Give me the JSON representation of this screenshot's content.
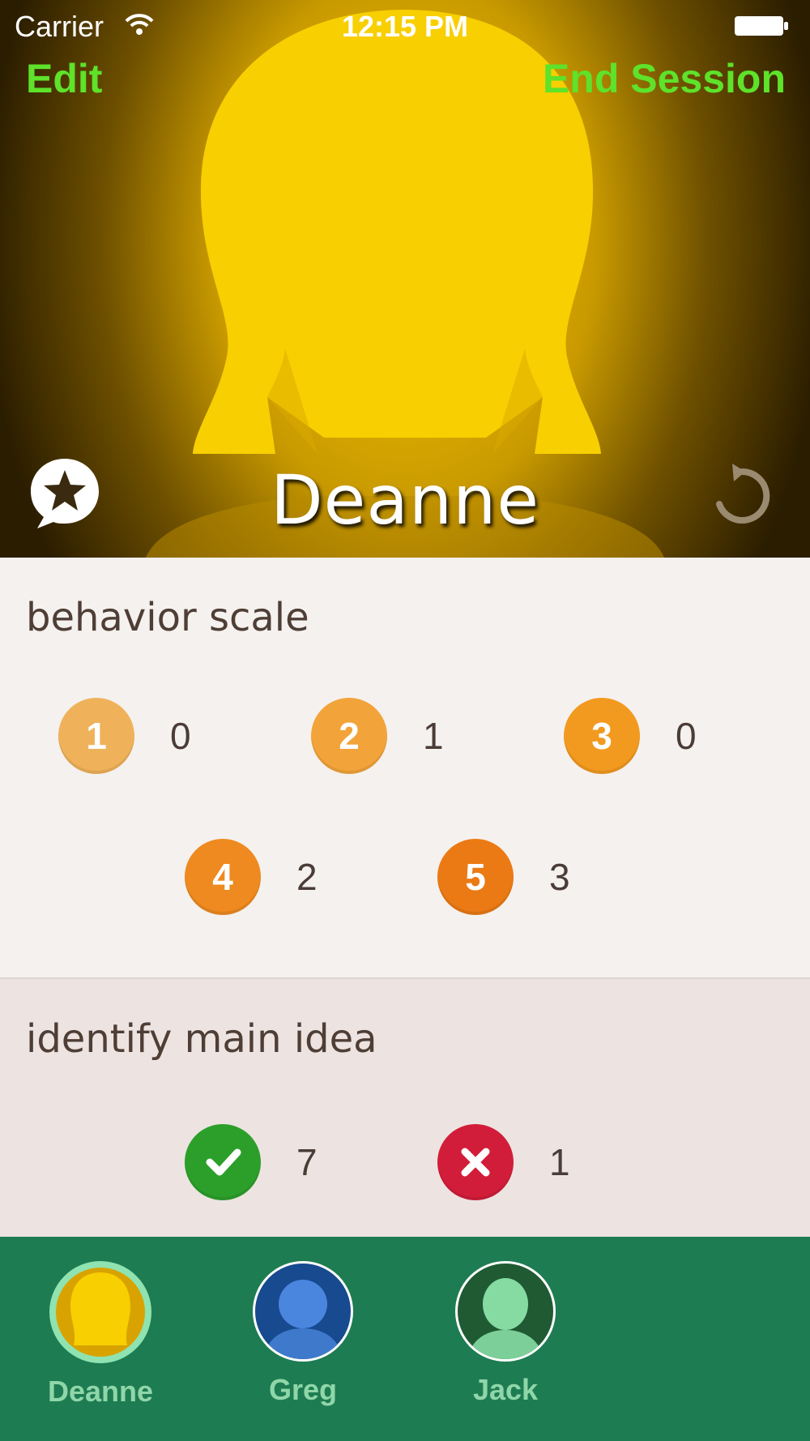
{
  "status_bar": {
    "carrier": "Carrier",
    "time": "12:15 PM"
  },
  "nav": {
    "left_label": "Edit",
    "right_label": "End Session",
    "accent_color": "#5ee22a"
  },
  "student": {
    "name": "Deanne"
  },
  "behavior_scale": {
    "title": "behavior scale",
    "items": [
      {
        "label": "1",
        "count": "0",
        "color": "#efb25a"
      },
      {
        "label": "2",
        "count": "1",
        "color": "#f2a43a"
      },
      {
        "label": "3",
        "count": "0",
        "color": "#f29a1f"
      },
      {
        "label": "4",
        "count": "2",
        "color": "#ee8a1f"
      },
      {
        "label": "5",
        "count": "3",
        "color": "#eb7a14"
      }
    ]
  },
  "main_idea": {
    "title": "identify main idea",
    "items": [
      {
        "icon": "check-icon",
        "count": "7",
        "color": "#2c9f2a"
      },
      {
        "icon": "x-icon",
        "count": "1",
        "color": "#d21d3a"
      }
    ]
  },
  "tabs": [
    {
      "label": "Deanne",
      "avatar_color": "#f5c400",
      "selected": true
    },
    {
      "label": "Greg",
      "avatar_color": "#3e7cd6",
      "selected": false
    },
    {
      "label": "Jack",
      "avatar_color": "#7fd39b",
      "selected": false
    }
  ],
  "colors": {
    "tab_bar": "#1e7c52",
    "tab_label": "#8fd6a9",
    "section_text": "#4e3e36"
  }
}
